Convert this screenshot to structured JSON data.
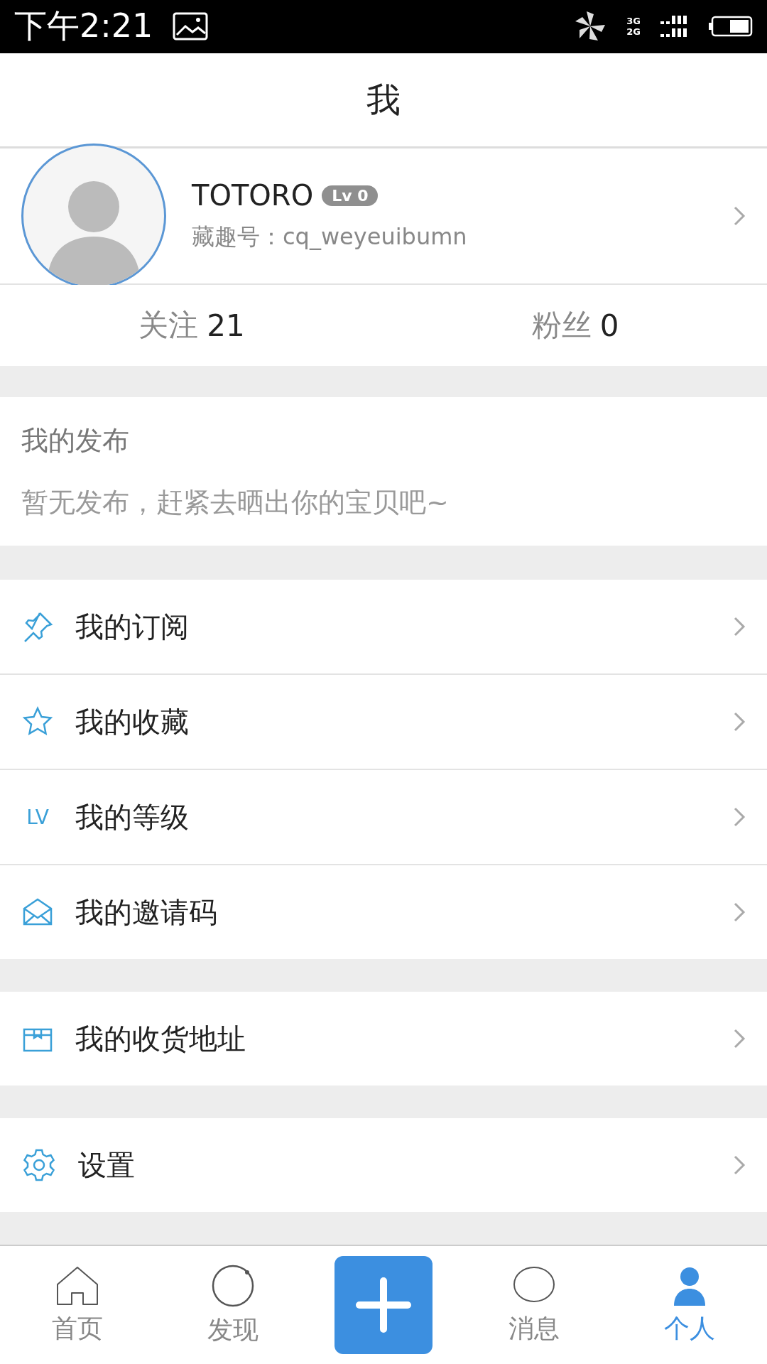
{
  "status_bar": {
    "time": "下午2:21",
    "network_top": "3G",
    "network_bottom": "2G"
  },
  "header": {
    "title": "我"
  },
  "profile": {
    "name": "TOTORO",
    "level_badge": "Lv 0",
    "id_label": "藏趣号：cq_weyeuibumn"
  },
  "stats": [
    {
      "label": "关注",
      "value": "21"
    },
    {
      "label": "粉丝",
      "value": "0"
    }
  ],
  "posts": {
    "title": "我的发布",
    "empty_text": "暂无发布，赶紧去晒出你的宝贝吧~"
  },
  "menu_groups": [
    [
      {
        "kind": "pin",
        "label": "我的订阅"
      },
      {
        "kind": "star",
        "label": "我的收藏"
      },
      {
        "kind": "text",
        "icon_text": "LV",
        "label": "我的等级"
      },
      {
        "kind": "mail",
        "label": "我的邀请码"
      }
    ],
    [
      {
        "kind": "box",
        "label": "我的收货地址"
      }
    ],
    [
      {
        "kind": "gear",
        "label": "设置"
      }
    ]
  ],
  "tab_bar": [
    {
      "kind": "home",
      "label": "首页",
      "selected": false
    },
    {
      "kind": "discover",
      "label": "发现",
      "selected": false
    },
    {
      "kind": "add"
    },
    {
      "kind": "message",
      "label": "消息",
      "selected": false
    },
    {
      "kind": "person",
      "label": "个人",
      "selected": true
    }
  ]
}
